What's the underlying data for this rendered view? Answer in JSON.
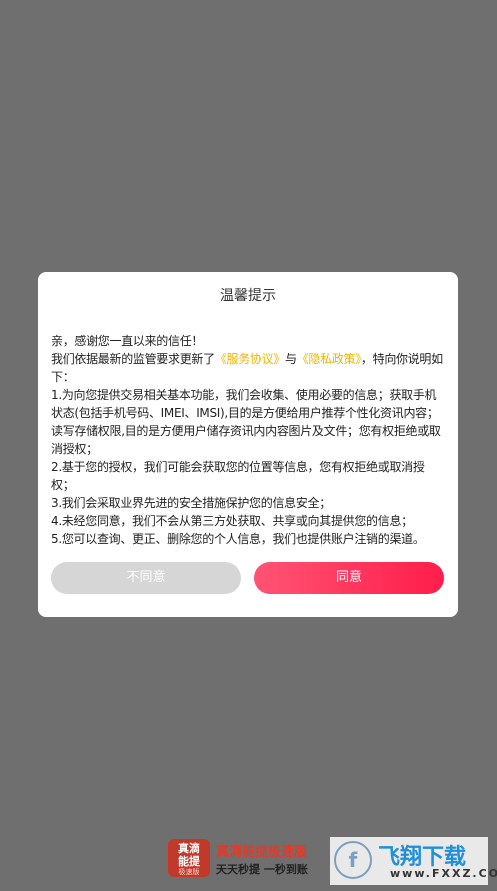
{
  "dialog": {
    "title": "温馨提示",
    "greeting": "亲，感谢您一直以来的信任！",
    "intro_prefix": "我们依据最新的监管要求更新了",
    "link_service": "《服务协议》",
    "intro_and": "与",
    "link_privacy": "《隐私政策》",
    "intro_suffix": "，特向你说明如下：",
    "items": [
      "1.为向您提供交易相关基本功能，我们会收集、使用必要的信息；获取手机状态(包括手机号码、IMEI、IMSI),目的是方便给用户推荐个性化资讯内容；读写存储权限,目的是方便用户储存资讯内内容图片及文件；您有权拒绝或取消授权；",
      "2.基于您的授权，我们可能会获取您的位置等信息，您有权拒绝或取消授权；",
      "3.我们会采取业界先进的安全措施保护您的信息安全；",
      "4.未经您同意，我们不会从第三方处获取、共享或向其提供您的信息；",
      "5.您可以查询、更正、删除您的个人信息，我们也提供账户注销的渠道。"
    ],
    "disagree_label": "不同意",
    "agree_label": "同意"
  },
  "footer": {
    "logo_line1": "真滴",
    "logo_line2": "能提",
    "logo_small": "极速版",
    "app_name": "真滴能提极速版",
    "slogan": "天天秒提 一秒到账",
    "watermark_text": "飞翔下载",
    "watermark_url": "www.FXXZ.COM"
  },
  "colors": {
    "overlay": "#6f6f6f",
    "link": "#f4b400",
    "agree": "#ff1d4b",
    "disagree": "#d6d6d6"
  }
}
